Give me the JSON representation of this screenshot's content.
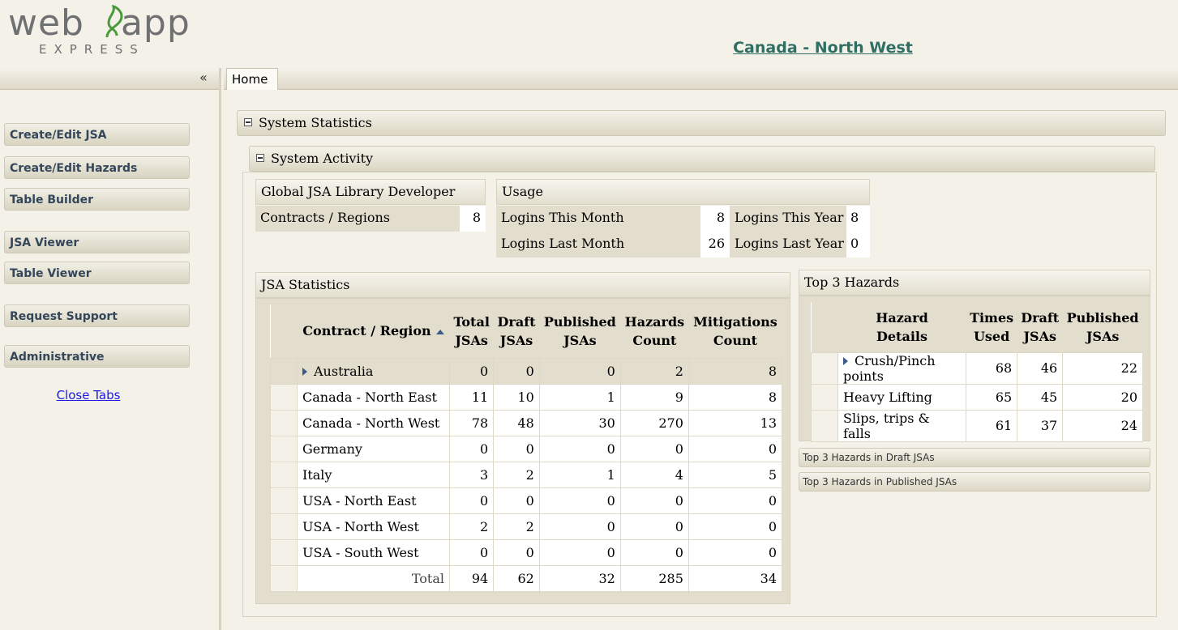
{
  "header": {
    "logo_word": "web app",
    "logo_sub": "EXPRESS",
    "title": "Canada - North West",
    "accent": "#2f6f63"
  },
  "sidebar": {
    "collapse_icon": "«",
    "items": [
      {
        "label": "Create/Edit JSA"
      },
      {
        "label": "Create/Edit Hazards"
      },
      {
        "label": "Table Builder"
      },
      {
        "label": "JSA Viewer"
      },
      {
        "label": "Table Viewer"
      },
      {
        "label": "Request Support"
      },
      {
        "label": "Administrative"
      }
    ],
    "close_tabs": "Close Tabs"
  },
  "tabs": [
    {
      "label": "Home"
    }
  ],
  "system_statistics": {
    "title": "System Statistics",
    "system_activity": {
      "title": "System Activity",
      "global": {
        "heading": "Global JSA Library Developer",
        "rows": [
          {
            "label": "Contracts / Regions",
            "value": "8"
          }
        ]
      },
      "usage": {
        "heading": "Usage",
        "logins_this_month_label": "Logins This Month",
        "logins_this_month": "8",
        "logins_this_year_label": "Logins This Year",
        "logins_this_year": "8",
        "logins_last_month_label": "Logins Last Month",
        "logins_last_month": "26",
        "logins_last_year_label": "Logins Last Year",
        "logins_last_year": "0"
      },
      "jsa_statistics": {
        "heading": "JSA Statistics",
        "columns": [
          {
            "l1": "Contract / Region",
            "l2": ""
          },
          {
            "l1": "Total",
            "l2": "JSAs"
          },
          {
            "l1": "Draft",
            "l2": "JSAs"
          },
          {
            "l1": "Published",
            "l2": "JSAs"
          },
          {
            "l1": "Hazards",
            "l2": "Count"
          },
          {
            "l1": "Mitigations",
            "l2": "Count"
          }
        ],
        "rows": [
          {
            "region": "Australia",
            "total": "0",
            "draft": "0",
            "published": "0",
            "hazards": "2",
            "mitigations": "8"
          },
          {
            "region": "Canada - North East",
            "total": "11",
            "draft": "10",
            "published": "1",
            "hazards": "9",
            "mitigations": "8"
          },
          {
            "region": "Canada - North West",
            "total": "78",
            "draft": "48",
            "published": "30",
            "hazards": "270",
            "mitigations": "13"
          },
          {
            "region": "Germany",
            "total": "0",
            "draft": "0",
            "published": "0",
            "hazards": "0",
            "mitigations": "0"
          },
          {
            "region": "Italy",
            "total": "3",
            "draft": "2",
            "published": "1",
            "hazards": "4",
            "mitigations": "5"
          },
          {
            "region": "USA - North East",
            "total": "0",
            "draft": "0",
            "published": "0",
            "hazards": "0",
            "mitigations": "0"
          },
          {
            "region": "USA - North West",
            "total": "2",
            "draft": "2",
            "published": "0",
            "hazards": "0",
            "mitigations": "0"
          },
          {
            "region": "USA - South West",
            "total": "0",
            "draft": "0",
            "published": "0",
            "hazards": "0",
            "mitigations": "0"
          }
        ],
        "totals": {
          "label": "Total",
          "total": "94",
          "draft": "62",
          "published": "32",
          "hazards": "285",
          "mitigations": "34"
        }
      },
      "top_hazards": {
        "heading": "Top 3 Hazards",
        "columns": [
          {
            "l1": "Hazard",
            "l2": "Details"
          },
          {
            "l1": "Times",
            "l2": "Used"
          },
          {
            "l1": "Draft",
            "l2": "JSAs"
          },
          {
            "l1": "Published",
            "l2": "JSAs"
          }
        ],
        "rows": [
          {
            "hazard": "Crush/Pinch points",
            "times": "68",
            "draft": "46",
            "published": "22"
          },
          {
            "hazard": "Heavy Lifting",
            "times": "65",
            "draft": "45",
            "published": "20"
          },
          {
            "hazard": "Slips, trips & falls",
            "times": "61",
            "draft": "37",
            "published": "24"
          }
        ],
        "draft_link": "Top 3 Hazards in Draft JSAs",
        "published_link": "Top 3 Hazards in Published JSAs"
      }
    }
  }
}
